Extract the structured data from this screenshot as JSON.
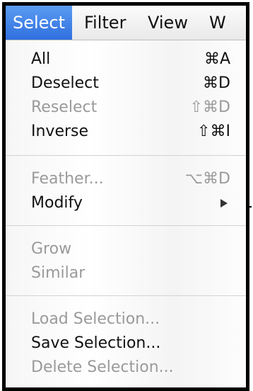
{
  "menubar": {
    "items": [
      {
        "label": "Select",
        "active": true
      },
      {
        "label": "Filter",
        "active": false
      },
      {
        "label": "View",
        "active": false
      },
      {
        "label": "W",
        "active": false
      }
    ]
  },
  "menu": {
    "items": [
      {
        "label": "All",
        "shortcut": "⌘A",
        "enabled": true
      },
      {
        "label": "Deselect",
        "shortcut": "⌘D",
        "enabled": true
      },
      {
        "label": "Reselect",
        "shortcut": "⇧⌘D",
        "enabled": false
      },
      {
        "label": "Inverse",
        "shortcut": "⇧⌘I",
        "enabled": true
      },
      {
        "label": "Feather...",
        "shortcut": "⌥⌘D",
        "enabled": false
      },
      {
        "label": "Modify",
        "shortcut": "",
        "enabled": true,
        "submenu": true
      },
      {
        "label": "Grow",
        "shortcut": "",
        "enabled": false
      },
      {
        "label": "Similar",
        "shortcut": "",
        "enabled": false
      },
      {
        "label": "Load Selection...",
        "shortcut": "",
        "enabled": false
      },
      {
        "label": "Save Selection...",
        "shortcut": "",
        "enabled": true
      },
      {
        "label": "Delete Selection...",
        "shortcut": "",
        "enabled": false
      }
    ]
  },
  "icons": {
    "submenu_arrow": "triangle-right-icon"
  },
  "colors": {
    "active_menu_bg": "#2f6fde",
    "enabled_text": "#111111",
    "disabled_text": "#9a9a9a"
  }
}
